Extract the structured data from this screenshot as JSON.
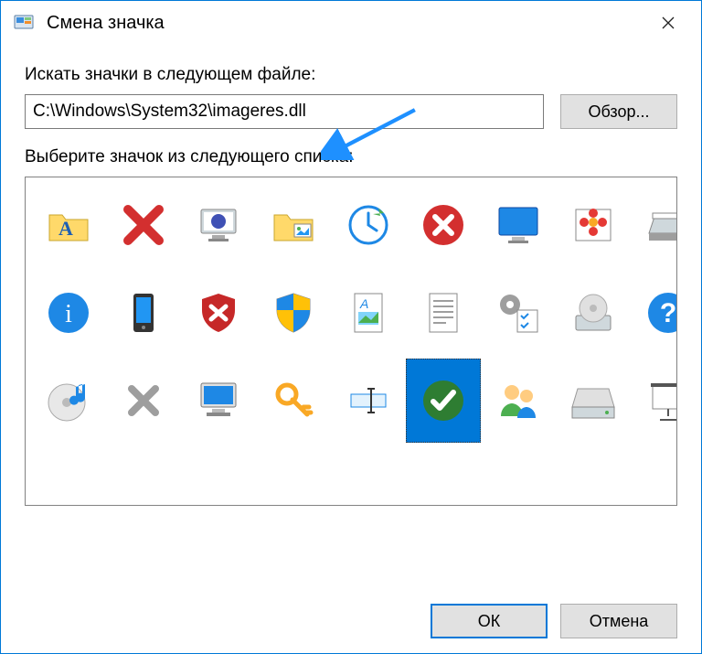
{
  "window": {
    "title": "Смена значка"
  },
  "labels": {
    "path_label": "Искать значки в следующем файле:",
    "list_label": "Выберите значок из следующего списка:"
  },
  "path": {
    "value": "C:\\Windows\\System32\\imageres.dll"
  },
  "buttons": {
    "browse": "Обзор...",
    "ok": "ОК",
    "cancel": "Отмена"
  },
  "selected_icon_index": 17,
  "icons": [
    {
      "name": "folder-font-a-icon"
    },
    {
      "name": "info-blue-icon"
    },
    {
      "name": "cd-music-icon"
    },
    {
      "name": "red-x-icon"
    },
    {
      "name": "smartphone-icon"
    },
    {
      "name": "gray-x-icon"
    },
    {
      "name": "monitor-orb-icon"
    },
    {
      "name": "shield-x-icon"
    },
    {
      "name": "computer-icon"
    },
    {
      "name": "folder-pictures-icon"
    },
    {
      "name": "uac-shield-icon"
    },
    {
      "name": "key-icon"
    },
    {
      "name": "clock-update-icon"
    },
    {
      "name": "document-image-icon"
    },
    {
      "name": "rename-caret-icon"
    },
    {
      "name": "error-red-circle-icon"
    },
    {
      "name": "document-lines-icon"
    },
    {
      "name": "success-green-check-icon"
    },
    {
      "name": "desktop-blue-icon"
    },
    {
      "name": "gear-checklist-icon"
    },
    {
      "name": "users-pair-icon"
    },
    {
      "name": "picture-flower-icon"
    },
    {
      "name": "disc-install-icon"
    },
    {
      "name": "drive-icon"
    },
    {
      "name": "scanner-icon"
    },
    {
      "name": "help-blue-icon"
    },
    {
      "name": "projector-screen-icon"
    },
    {
      "name": "shield-warning-icon"
    },
    {
      "name": "apps-blocks-icon"
    },
    {
      "name": "folder-favorites-icon"
    },
    {
      "name": "checklist-window-icon"
    },
    {
      "name": "warning-triangle-icon"
    },
    {
      "name": "users-pair-2-icon"
    },
    {
      "name": "drive-external-icon"
    },
    {
      "name": "hard-drive-icon"
    },
    {
      "name": "run-fast-icon"
    },
    {
      "name": "shield-help-icon"
    },
    {
      "name": "folder-music-icon"
    },
    {
      "name": "folder-search-icon"
    },
    {
      "name": "list-options-icon"
    }
  ]
}
